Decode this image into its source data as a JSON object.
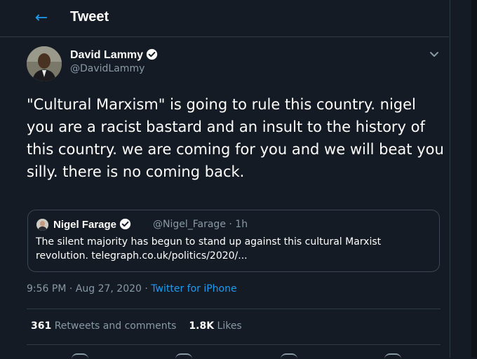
{
  "header": {
    "title": "Tweet",
    "back_icon": "arrow-left-icon"
  },
  "tweet": {
    "author_name": "David Lammy",
    "author_handle": "@DavidLammy",
    "text": "\"Cultural Marxism\" is going to rule this country. nigel you are a racist bastard and an insult to the history of this country. we are coming for you and we will beat you silly. there is no coming back.",
    "time": "9:56 PM",
    "separator": "·",
    "date": "Aug 27, 2020",
    "source": "Twitter for iPhone"
  },
  "quoted": {
    "author_name": "Nigel Farage",
    "author_handle": "@Nigel_Farage",
    "age": "1h",
    "text": "The silent majority has begun to stand up against this cultural Marxist revolution. telegraph.co.uk/politics/2020/..."
  },
  "stats": {
    "retweets_count": "361",
    "retweets_label": "Retweets and comments",
    "likes_count": "1.8K",
    "likes_label": "Likes"
  },
  "colors": {
    "accent": "#1d9bf0",
    "background": "#151b24",
    "muted": "#8899a6"
  }
}
